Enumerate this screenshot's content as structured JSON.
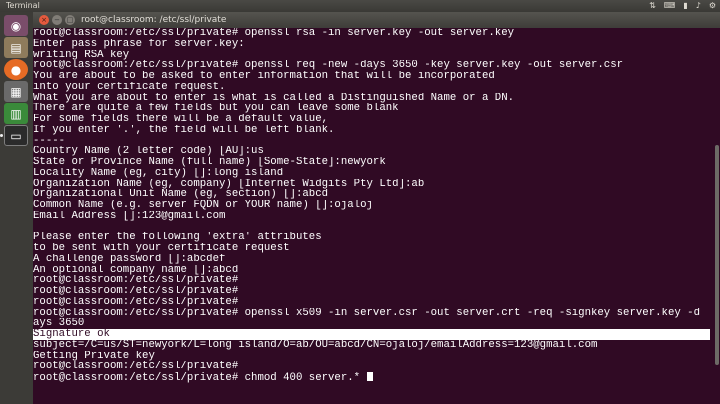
{
  "panel": {
    "app_name": "Terminal"
  },
  "window": {
    "title": "root@classroom: /etc/ssl/private"
  },
  "launcher": {
    "items": [
      {
        "icon": "dash-icon"
      },
      {
        "icon": "files-icon"
      },
      {
        "icon": "firefox-icon"
      },
      {
        "icon": "office-icon"
      },
      {
        "icon": "calc-icon"
      },
      {
        "icon": "terminal-icon"
      }
    ]
  },
  "terminal": {
    "lines": [
      "root@classroom:/etc/ssl/private# openssl rsa -in server.key -out server.key",
      "Enter pass phrase for server.key:",
      "writing RSA key",
      "root@classroom:/etc/ssl/private# openssl req -new -days 3650 -key server.key -out server.csr",
      "You are about to be asked to enter information that will be incorporated",
      "into your certificate request.",
      "What you are about to enter is what is called a Distinguished Name or a DN.",
      "There are quite a few fields but you can leave some blank",
      "For some fields there will be a default value,",
      "If you enter '.', the field will be left blank.",
      "-----",
      "Country Name (2 letter code) [AU]:us",
      "State or Province Name (full name) [Some-State]:newyork",
      "Locality Name (eg, city) []:long island",
      "Organization Name (eg, company) [Internet Widgits Pty Ltd]:ab",
      "Organizational Unit Name (eg, section) []:abcd",
      "Common Name (e.g. server FQDN or YOUR name) []:ojaloj",
      "Email Address []:123@gmail.com",
      "",
      "Please enter the following 'extra' attributes",
      "to be sent with your certificate request",
      "A challenge password []:abcdef",
      "An optional company name []:abcd",
      "root@classroom:/etc/ssl/private#",
      "root@classroom:/etc/ssl/private#",
      "root@classroom:/etc/ssl/private#",
      "root@classroom:/etc/ssl/private# openssl x509 -in server.csr -out server.crt -req -signkey server.key -d",
      "ays 3650",
      "Signature ok",
      "subject=/C=us/ST=newyork/L=long island/O=ab/OU=abcd/CN=ojaloj/emailAddress=123@gmail.com",
      "Getting Private key",
      "root@classroom:/etc/ssl/private#",
      "root@classroom:/etc/ssl/private# chmod 400 server.*"
    ]
  }
}
